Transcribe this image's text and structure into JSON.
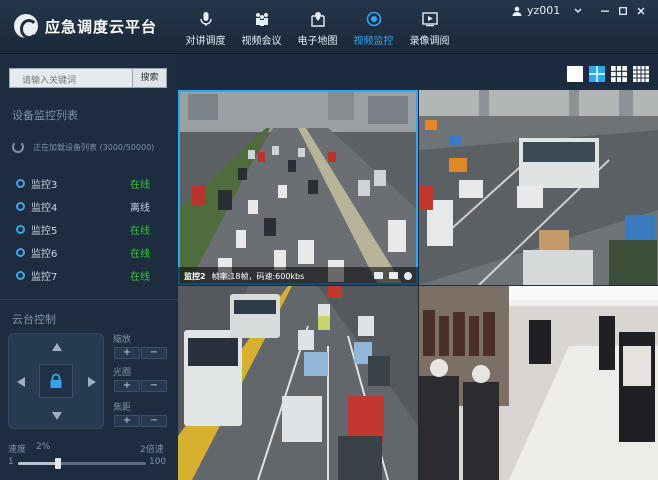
{
  "app": {
    "title": "应急调度云平台"
  },
  "nav": [
    {
      "label": "对讲调度",
      "icon": "microphone-icon",
      "active": false
    },
    {
      "label": "视频会议",
      "icon": "people-icon",
      "active": false
    },
    {
      "label": "电子地图",
      "icon": "map-pin-icon",
      "active": false
    },
    {
      "label": "视频监控",
      "icon": "camera-icon",
      "active": true
    },
    {
      "label": "录像调阅",
      "icon": "play-icon",
      "active": false
    }
  ],
  "user": {
    "name": "yz001",
    "icon": "user-icon"
  },
  "window": {
    "minimize": "–",
    "restore": "□",
    "close": "×"
  },
  "search": {
    "placeholder": "请输入关键词",
    "button": "搜索"
  },
  "device_panel": {
    "title": "设备监控列表",
    "loading": "正在加载设备列表 (3000/50000)",
    "devices": [
      {
        "name": "监控3",
        "status": "在线",
        "online": true
      },
      {
        "name": "监控4",
        "status": "离线",
        "online": false
      },
      {
        "name": "监控5",
        "status": "在线",
        "online": true
      },
      {
        "name": "监控6",
        "status": "在线",
        "online": true
      },
      {
        "name": "监控7",
        "status": "在线",
        "online": true
      }
    ]
  },
  "ptz": {
    "title": "云台控制",
    "controls": [
      {
        "label": "縮放",
        "plus": "+",
        "minus": "−"
      },
      {
        "label": "光圈",
        "plus": "+",
        "minus": "−"
      },
      {
        "label": "焦距",
        "plus": "+",
        "minus": "−"
      }
    ],
    "speed": {
      "label": "速度",
      "value": "2%",
      "right_label": "2倍速",
      "min": "1",
      "max": "100",
      "fraction": 0.02
    }
  },
  "layouts": [
    "1x1",
    "2x2",
    "3x3",
    "4x4"
  ],
  "cameras": [
    {
      "name": "监控2",
      "info": "帧率:18帧，码速:600kbs"
    },
    {
      "name": "",
      "info": ""
    },
    {
      "name": "",
      "info": ""
    },
    {
      "name": "",
      "info": ""
    }
  ],
  "colors": {
    "accent": "#2fa8f2",
    "online": "#39c43c",
    "offline": "#c8d3df"
  }
}
